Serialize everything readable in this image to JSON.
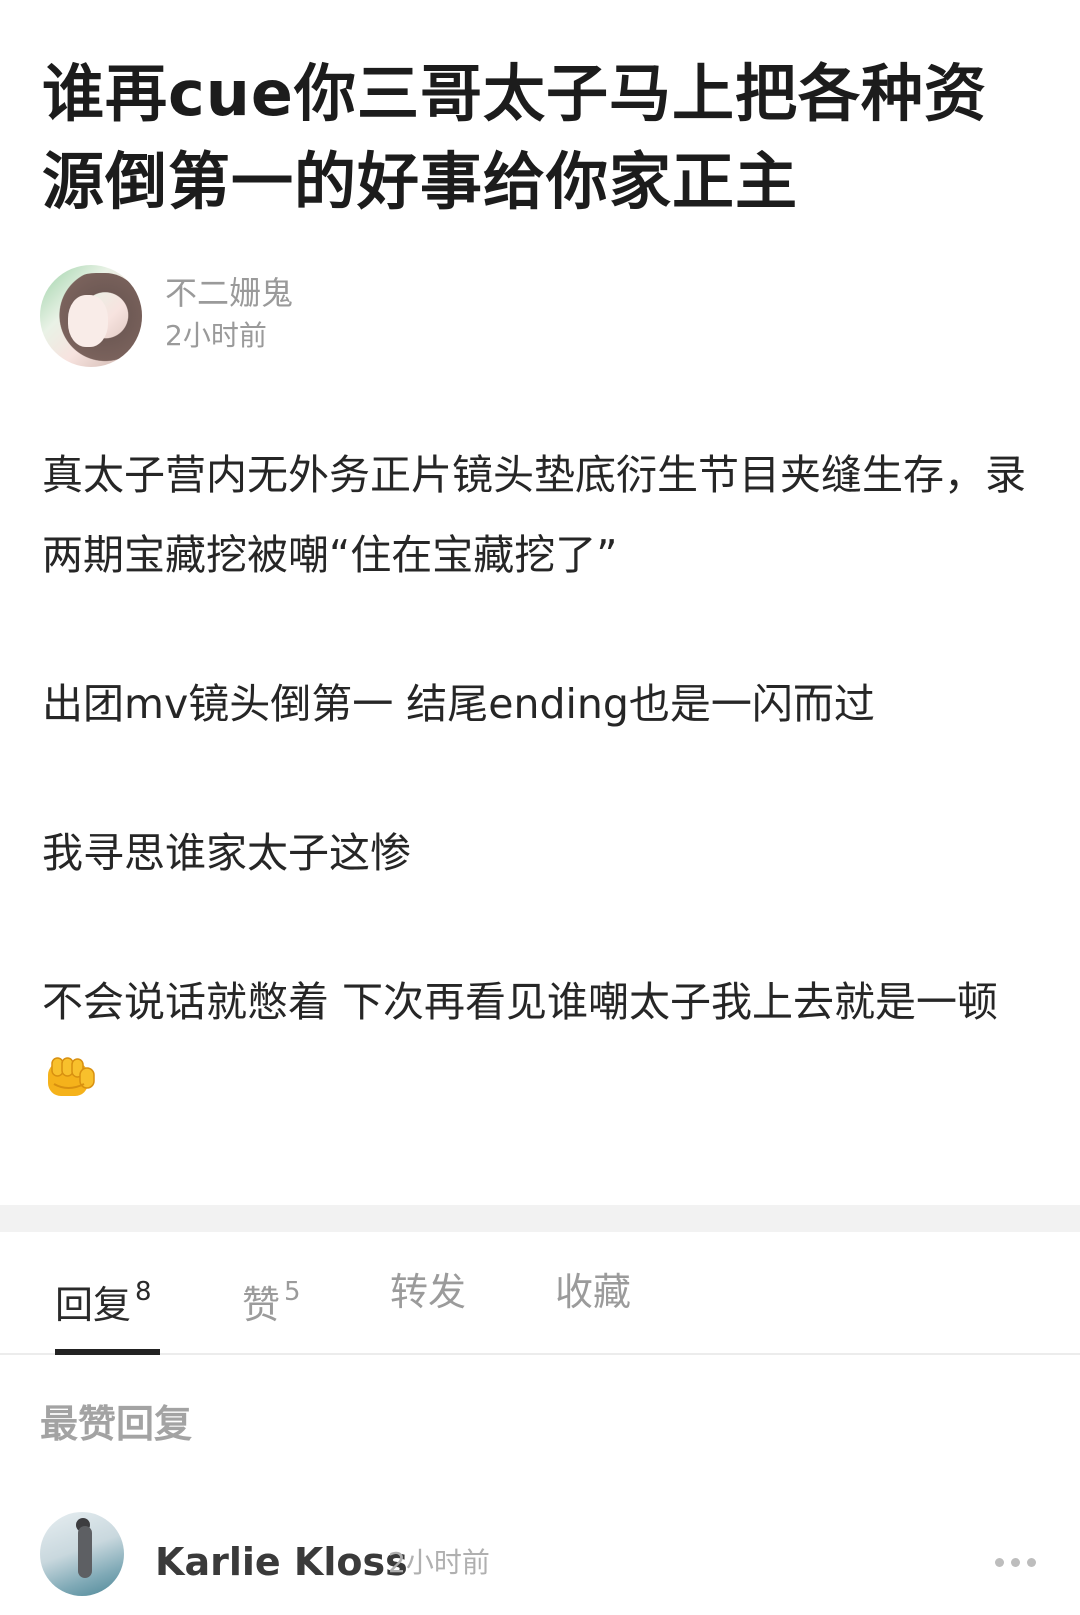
{
  "post": {
    "title": "谁再cue你三哥太子马上把各种资源倒第一的好事给你家正主",
    "author": "不二姗鬼",
    "time": "2小时前",
    "paragraphs": [
      "真太子营内无外务正片镜头垫底衍生节目夹缝生存，录两期宝藏挖被嘲“住在宝藏挖了”",
      "出团mv镜头倒第一 结尾ending也是一闪而过",
      "我寻思谁家太子这惨",
      "不会说话就憋着 下次再看见谁嘲太子我上去就是一顿"
    ],
    "last_paragraph_emoji": "fist-icon"
  },
  "tabs": {
    "replies": {
      "label": "回复",
      "count": "8"
    },
    "likes": {
      "label": "赞",
      "count": "5"
    },
    "forward": {
      "label": "转发"
    },
    "collect": {
      "label": "收藏"
    },
    "active": "replies"
  },
  "best_replies": {
    "heading": "最赞回复",
    "items": [
      {
        "username": "Karlie Kloss",
        "time": "2小时前"
      }
    ]
  }
}
